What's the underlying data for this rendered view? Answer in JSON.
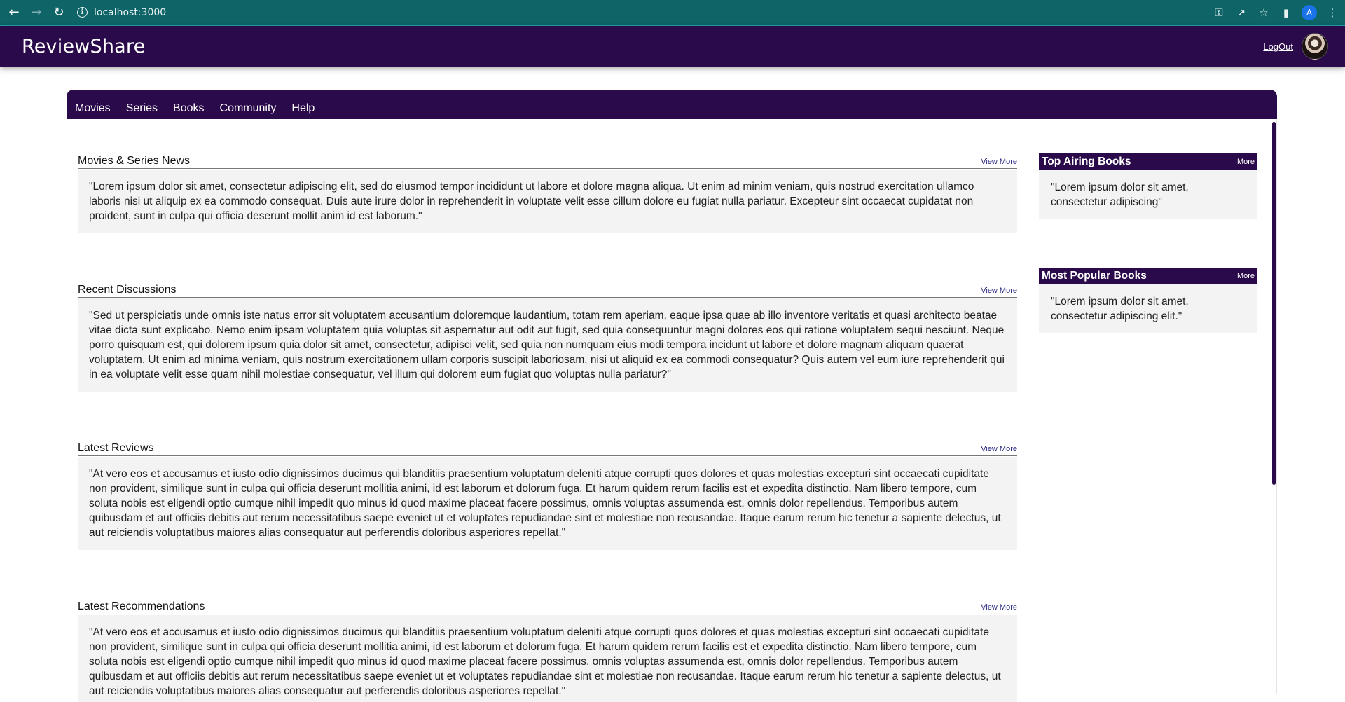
{
  "browser": {
    "url": "localhost:3000",
    "profile_initial": "A",
    "icons": {
      "back": "back-arrow-icon",
      "forward": "forward-arrow-icon",
      "reload": "reload-icon",
      "site_info": "info-icon",
      "key": "key-icon",
      "share": "share-icon",
      "bookmark": "star-icon",
      "sidepanel": "side-panel-icon",
      "menu": "kebab-menu-icon"
    }
  },
  "header": {
    "brand": "ReviewShare",
    "logout_label": "LogOut",
    "background_color": "#2a0a4a"
  },
  "nav": {
    "items": [
      {
        "label": "Movies"
      },
      {
        "label": "Series"
      },
      {
        "label": "Books"
      },
      {
        "label": "Community"
      },
      {
        "label": "Help"
      }
    ]
  },
  "sections": [
    {
      "title": "Movies & Series News",
      "view_more": "View More",
      "body": "\"Lorem ipsum dolor sit amet, consectetur adipiscing elit, sed do eiusmod tempor incididunt ut labore et dolore magna aliqua. Ut enim ad minim veniam, quis nostrud exercitation ullamco laboris nisi ut aliquip ex ea commodo consequat. Duis aute irure dolor in reprehenderit in voluptate velit esse cillum dolore eu fugiat nulla pariatur. Excepteur sint occaecat cupidatat non proident, sunt in culpa qui officia deserunt mollit anim id est laborum.\""
    },
    {
      "title": "Recent Discussions",
      "view_more": "View More",
      "body": "\"Sed ut perspiciatis unde omnis iste natus error sit voluptatem accusantium doloremque laudantium, totam rem aperiam, eaque ipsa quae ab illo inventore veritatis et quasi architecto beatae vitae dicta sunt explicabo. Nemo enim ipsam voluptatem quia voluptas sit aspernatur aut odit aut fugit, sed quia consequuntur magni dolores eos qui ratione voluptatem sequi nesciunt. Neque porro quisquam est, qui dolorem ipsum quia dolor sit amet, consectetur, adipisci velit, sed quia non numquam eius modi tempora incidunt ut labore et dolore magnam aliquam quaerat voluptatem. Ut enim ad minima veniam, quis nostrum exercitationem ullam corporis suscipit laboriosam, nisi ut aliquid ex ea commodi consequatur? Quis autem vel eum iure reprehenderit qui in ea voluptate velit esse quam nihil molestiae consequatur, vel illum qui dolorem eum fugiat quo voluptas nulla pariatur?\""
    },
    {
      "title": "Latest Reviews",
      "view_more": "View More",
      "body": "\"At vero eos et accusamus et iusto odio dignissimos ducimus qui blanditiis praesentium voluptatum deleniti atque corrupti quos dolores et quas molestias excepturi sint occaecati cupiditate non provident, similique sunt in culpa qui officia deserunt mollitia animi, id est laborum et dolorum fuga. Et harum quidem rerum facilis est et expedita distinctio. Nam libero tempore, cum soluta nobis est eligendi optio cumque nihil impedit quo minus id quod maxime placeat facere possimus, omnis voluptas assumenda est, omnis dolor repellendus. Temporibus autem quibusdam et aut officiis debitis aut rerum necessitatibus saepe eveniet ut et voluptates repudiandae sint et molestiae non recusandae. Itaque earum rerum hic tenetur a sapiente delectus, ut aut reiciendis voluptatibus maiores alias consequatur aut perferendis doloribus asperiores repellat.\""
    },
    {
      "title": "Latest Recommendations",
      "view_more": "View More",
      "body": "\"At vero eos et accusamus et iusto odio dignissimos ducimus qui blanditiis praesentium voluptatum deleniti atque corrupti quos dolores et quas molestias excepturi sint occaecati cupiditate non provident, similique sunt in culpa qui officia deserunt mollitia animi, id est laborum et dolorum fuga. Et harum quidem rerum facilis est et expedita distinctio. Nam libero tempore, cum soluta nobis est eligendi optio cumque nihil impedit quo minus id quod maxime placeat facere possimus, omnis voluptas assumenda est, omnis dolor repellendus. Temporibus autem quibusdam et aut officiis debitis aut rerum necessitatibus saepe eveniet ut et voluptates repudiandae sint et molestiae non recusandae. Itaque earum rerum hic tenetur a sapiente delectus, ut aut reiciendis voluptatibus maiores alias consequatur aut perferendis doloribus asperiores repellat.\""
    }
  ],
  "sidebar": {
    "widgets": [
      {
        "title": "Top Airing Books",
        "more": "More",
        "body": "\"Lorem ipsum dolor sit amet, consectetur adipiscing\""
      },
      {
        "title": "Most Popular Books",
        "more": "More",
        "body": "\"Lorem ipsum dolor sit amet, consectetur adipiscing elit.\""
      }
    ]
  }
}
